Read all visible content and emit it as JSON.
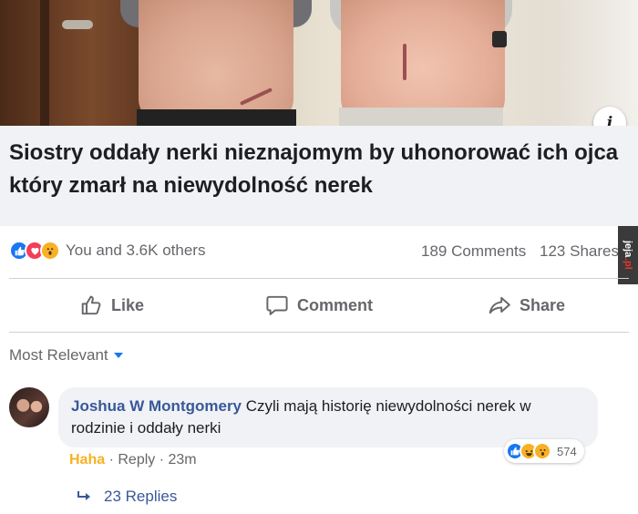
{
  "post": {
    "headline": "Siostry oddały nerki nieznajomym by uhonorować ich ojca który zmarł na niewydolność nerek",
    "info_icon": "i"
  },
  "reactions": {
    "icons": [
      "like-icon",
      "love-icon",
      "wow-icon"
    ],
    "summary": "You and 3.6K others",
    "comments_count": "189 Comments",
    "shares_count": "123 Shares"
  },
  "actions": {
    "like_label": "Like",
    "comment_label": "Comment",
    "share_label": "Share"
  },
  "watermark": {
    "prefix": "jeja",
    "suffix": ".pl"
  },
  "comments": {
    "sort_label": "Most Relevant",
    "items": [
      {
        "author": "Joshua W Montgomery",
        "text": "Czyli mają historię niewydolności nerek w rodzinie i oddały nerki",
        "reaction_label": "Haha",
        "reply_label": "Reply",
        "time": "23m",
        "reaction_count": "574",
        "replies_label": "23 Replies"
      }
    ]
  },
  "colors": {
    "facebook_blue": "#1877f2",
    "link_blue": "#385898",
    "haha_yellow": "#f7b125",
    "muted_gray": "#65676b"
  }
}
